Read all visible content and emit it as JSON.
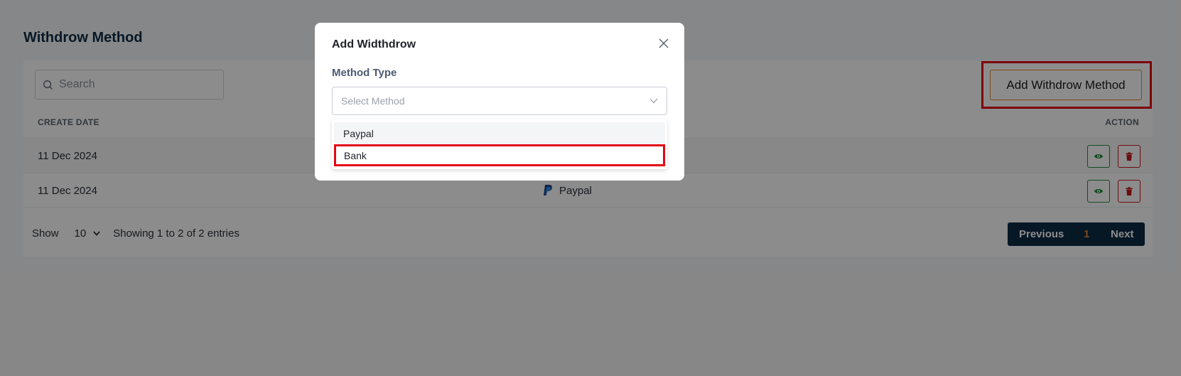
{
  "page": {
    "title": "Withdrow Method"
  },
  "toolbar": {
    "search_placeholder": "Search",
    "add_button_label": "Add Withdrow Method"
  },
  "table": {
    "columns": {
      "create_date": "CREATE DATE",
      "action": "ACTION"
    },
    "rows": [
      {
        "create_date": "11 Dec 2024",
        "method": "",
        "method_icon": ""
      },
      {
        "create_date": "11 Dec 2024",
        "method": "Paypal",
        "method_icon": "paypal-icon"
      }
    ]
  },
  "footer": {
    "show_label": "Show",
    "per_page": "10",
    "entries_text": "Showing 1 to 2 of 2 entries",
    "pagination": {
      "previous": "Previous",
      "current": "1",
      "next": "Next"
    }
  },
  "modal": {
    "title": "Add Widthdrow",
    "method_type_label": "Method Type",
    "select_placeholder": "Select Method",
    "options": [
      "Paypal",
      "Bank"
    ]
  },
  "colors": {
    "brand_dark": "#0b2a45",
    "accent_orange": "#e0882c",
    "view_green": "#1f8a3c",
    "delete_red": "#c4161c",
    "highlight_red": "#e30613"
  }
}
